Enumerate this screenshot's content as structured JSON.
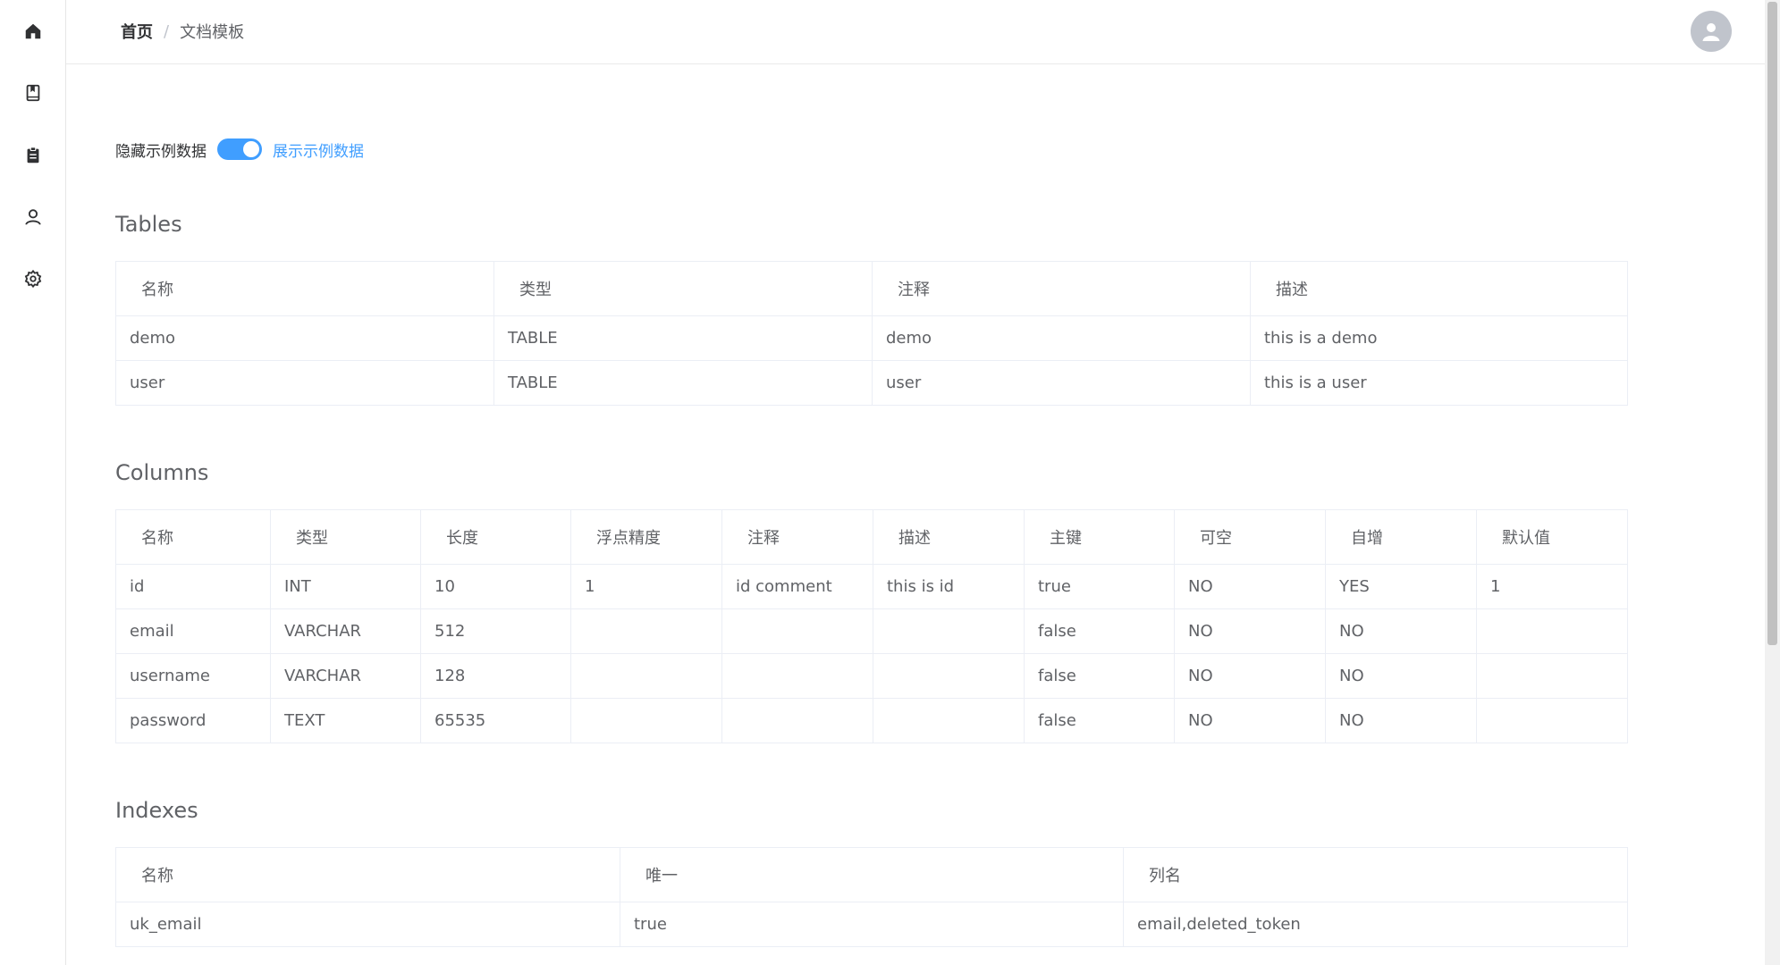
{
  "breadcrumb": {
    "home": "首页",
    "separator": "/",
    "current": "文档模板"
  },
  "sidebar": {
    "items": [
      {
        "name": "home-icon"
      },
      {
        "name": "book-icon"
      },
      {
        "name": "clipboard-icon"
      },
      {
        "name": "user-icon"
      },
      {
        "name": "gear-icon"
      }
    ]
  },
  "toggle": {
    "off_label": "隐藏示例数据",
    "on_label": "展示示例数据",
    "checked": true
  },
  "colors": {
    "accent": "#409eff",
    "border": "#ebeef5",
    "text": "#606266"
  },
  "tables": {
    "title": "Tables",
    "headers": [
      "名称",
      "类型",
      "注释",
      "描述"
    ],
    "rows": [
      [
        "demo",
        "TABLE",
        "demo",
        "this is a demo"
      ],
      [
        "user",
        "TABLE",
        "user",
        "this is a user"
      ]
    ]
  },
  "columns": {
    "title": "Columns",
    "headers": [
      "名称",
      "类型",
      "长度",
      "浮点精度",
      "注释",
      "描述",
      "主键",
      "可空",
      "自增",
      "默认值"
    ],
    "rows": [
      [
        "id",
        "INT",
        "10",
        "1",
        "id comment",
        "this is id",
        "true",
        "NO",
        "YES",
        "1"
      ],
      [
        "email",
        "VARCHAR",
        "512",
        "",
        "",
        "",
        "false",
        "NO",
        "NO",
        ""
      ],
      [
        "username",
        "VARCHAR",
        "128",
        "",
        "",
        "",
        "false",
        "NO",
        "NO",
        ""
      ],
      [
        "password",
        "TEXT",
        "65535",
        "",
        "",
        "",
        "false",
        "NO",
        "NO",
        ""
      ]
    ]
  },
  "indexes": {
    "title": "Indexes",
    "headers": [
      "名称",
      "唯一",
      "列名"
    ],
    "rows": [
      [
        "uk_email",
        "true",
        "email,deleted_token"
      ]
    ]
  }
}
